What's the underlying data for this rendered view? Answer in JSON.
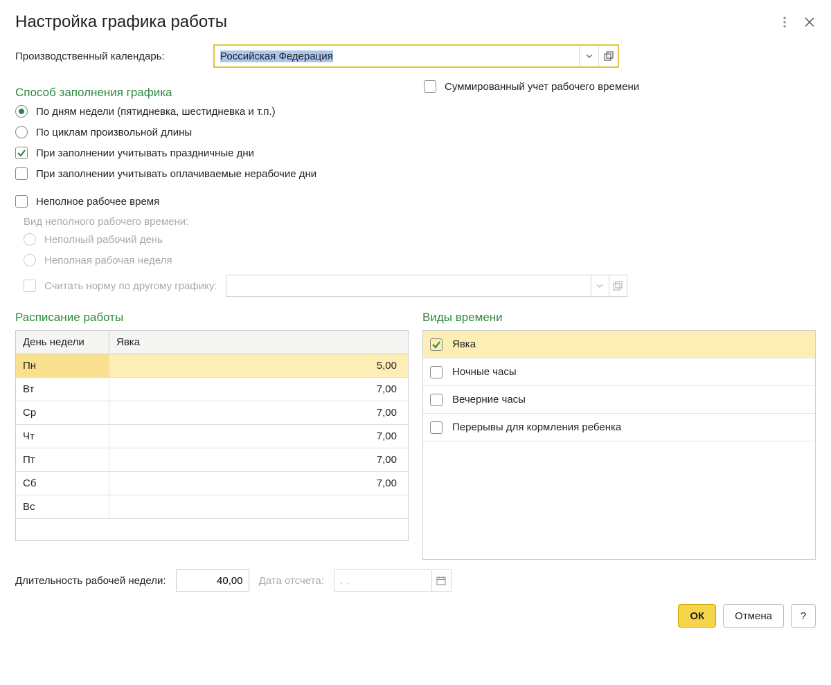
{
  "header": {
    "title": "Настройка графика работы"
  },
  "calendar": {
    "label": "Производственный календарь:",
    "value": "Российская Федерация"
  },
  "fill_method": {
    "title": "Способ заполнения графика",
    "options": {
      "by_weekdays": "По дням недели (пятидневка, шестидневка и т.п.)",
      "by_cycles": "По циклам произвольной длины"
    },
    "selected": "by_weekdays",
    "consider_holidays": {
      "label": "При заполнении учитывать праздничные дни",
      "checked": true
    },
    "consider_paid_nonwork": {
      "label": "При заполнении учитывать оплачиваемые нерабочие дни",
      "checked": false
    }
  },
  "summarized": {
    "label": "Суммированный учет рабочего времени",
    "checked": false
  },
  "part_time": {
    "label": "Неполное рабочее время",
    "checked": false,
    "type_label": "Вид неполного рабочего времени:",
    "options": {
      "day": "Неполный рабочий день",
      "week": "Неполная рабочая неделя"
    },
    "norm_by_other": {
      "label": "Считать норму по другому графику:",
      "checked": false
    }
  },
  "schedule": {
    "title": "Расписание работы",
    "columns": {
      "day": "День недели",
      "attendance": "Явка"
    },
    "rows": [
      {
        "day": "Пн",
        "value": "5,00",
        "selected": true
      },
      {
        "day": "Вт",
        "value": "7,00"
      },
      {
        "day": "Ср",
        "value": "7,00"
      },
      {
        "day": "Чт",
        "value": "7,00"
      },
      {
        "day": "Пт",
        "value": "7,00"
      },
      {
        "day": "Сб",
        "value": "7,00"
      },
      {
        "day": "Вс",
        "value": ""
      }
    ]
  },
  "time_types": {
    "title": "Виды времени",
    "items": [
      {
        "label": "Явка",
        "checked": true,
        "selected": true
      },
      {
        "label": "Ночные часы",
        "checked": false
      },
      {
        "label": "Вечерние часы",
        "checked": false
      },
      {
        "label": "Перерывы для кормления ребенка",
        "checked": false
      }
    ]
  },
  "footer": {
    "week_duration_label": "Длительность рабочей недели:",
    "week_duration_value": "40,00",
    "start_date_label": "Дата отсчета:",
    "start_date_value": " .  . "
  },
  "actions": {
    "ok": "ОК",
    "cancel": "Отмена",
    "help": "?"
  }
}
